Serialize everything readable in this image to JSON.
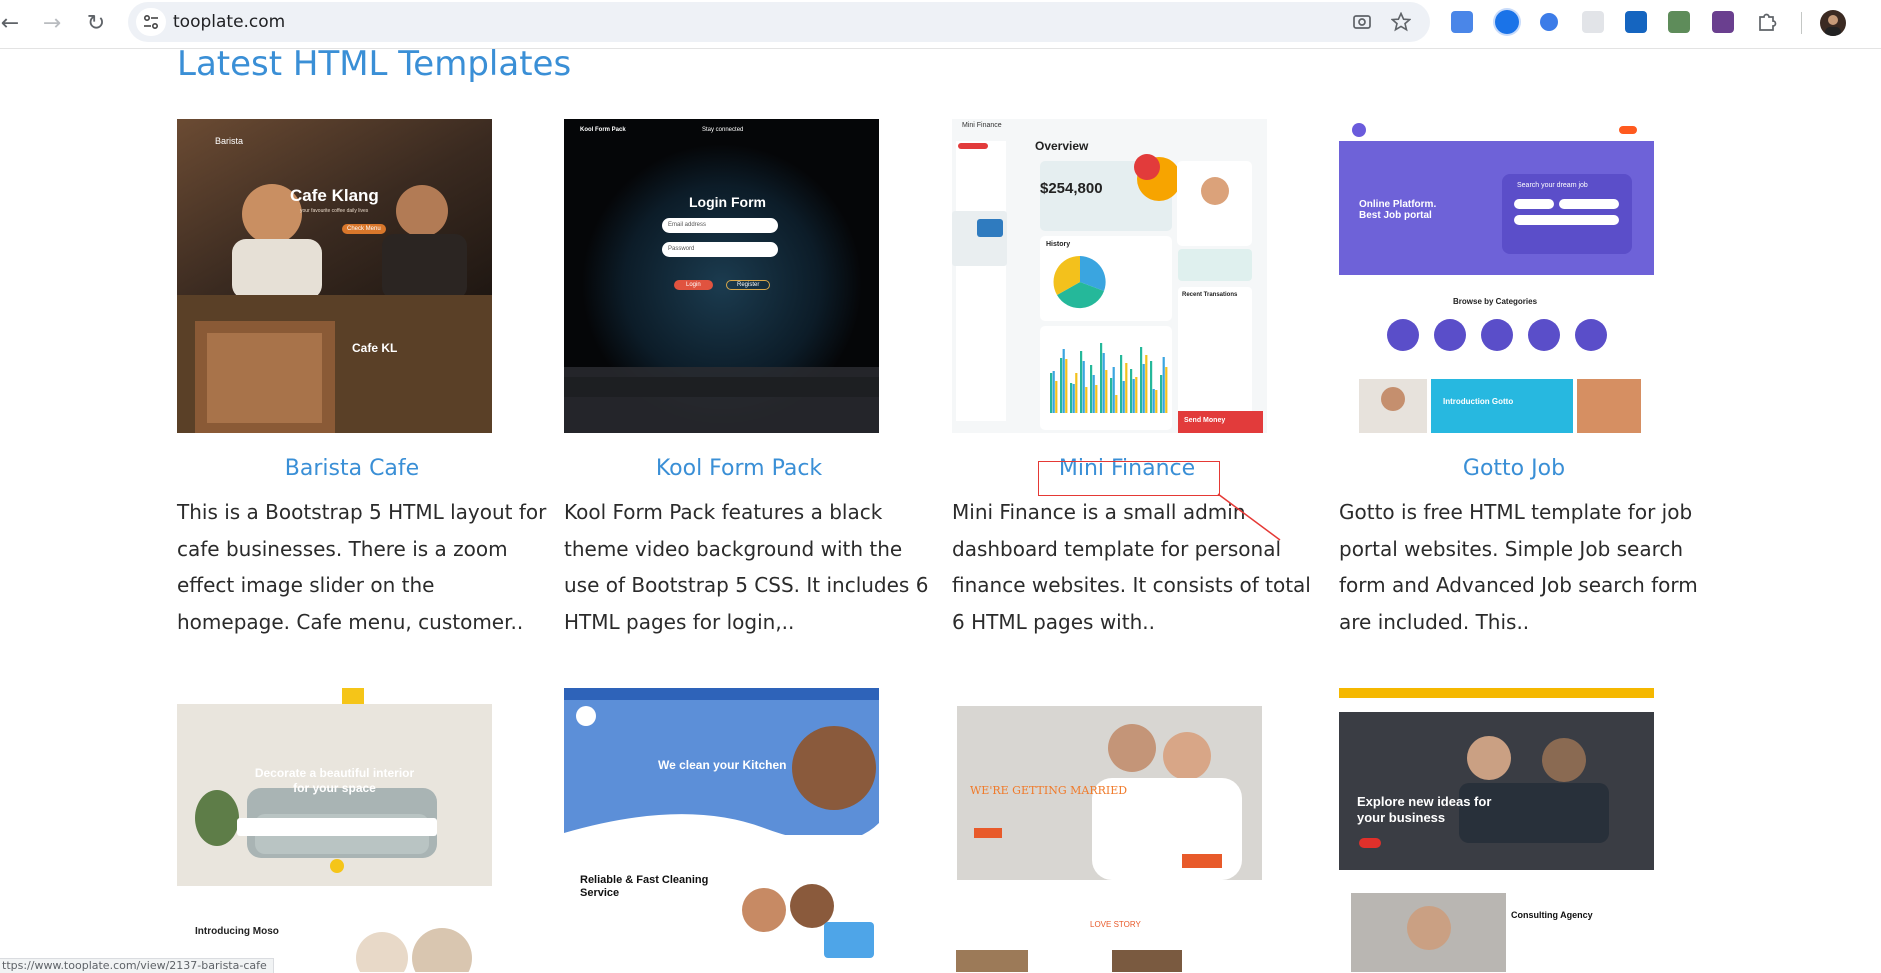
{
  "browser": {
    "url": "tooplate.com",
    "status_url": "ttps://www.tooplate.com/view/2137-barista-cafe"
  },
  "page": {
    "heading": "Latest HTML Templates"
  },
  "templates": [
    {
      "title": "Barista Cafe",
      "description": "This is a Bootstrap 5 HTML layout for cafe businesses. There is a zoom effect image slider on the homepage. Cafe menu, customer..",
      "preview_text": {
        "brand": "Barista",
        "hero": "Cafe Klang",
        "tagline": "your favourite coffee daily lives",
        "button": "Check Menu",
        "section": "Cafe KL"
      }
    },
    {
      "title": "Kool Form Pack",
      "description": "Kool Form Pack features a black theme video background with the use of Bootstrap 5 CSS. It includes 6 HTML pages for login,..",
      "preview_text": {
        "brand": "Kool Form Pack",
        "stay": "Stay connected",
        "heading": "Login Form",
        "email": "Email address",
        "password": "Password",
        "login": "Login",
        "register": "Register"
      }
    },
    {
      "title": "Mini Finance",
      "description": "Mini Finance is a small admin dashboard template for personal finance websites. It consists of total 6 HTML pages with..",
      "preview_text": {
        "brand": "Mini Finance",
        "overview": "Overview",
        "balance": "$254,800",
        "history": "History",
        "transactions": "Recent Transations",
        "send": "Send Money"
      }
    },
    {
      "title": "Gotto Job",
      "description": "Gotto is free HTML template for job portal websites. Simple Job search form and Advanced Job search form are included. This..",
      "preview_text": {
        "hero": "Online Platform. Best Job portal",
        "search": "Search your dream job",
        "categories": "Browse by Categories",
        "intro": "Introduction Gotto"
      }
    }
  ],
  "second_row_previews": [
    {
      "hero": "Decorate a beautiful interior for your space",
      "sub": "Introducing Moso"
    },
    {
      "hero": "We clean your Kitchen",
      "sub": "Reliable & Fast Cleaning Service"
    },
    {
      "hero": "WE'RE GETTING MARRIED",
      "sub": "LOVE STORY"
    },
    {
      "hero": "Explore new ideas for your business",
      "sub": "Consulting Agency"
    }
  ]
}
